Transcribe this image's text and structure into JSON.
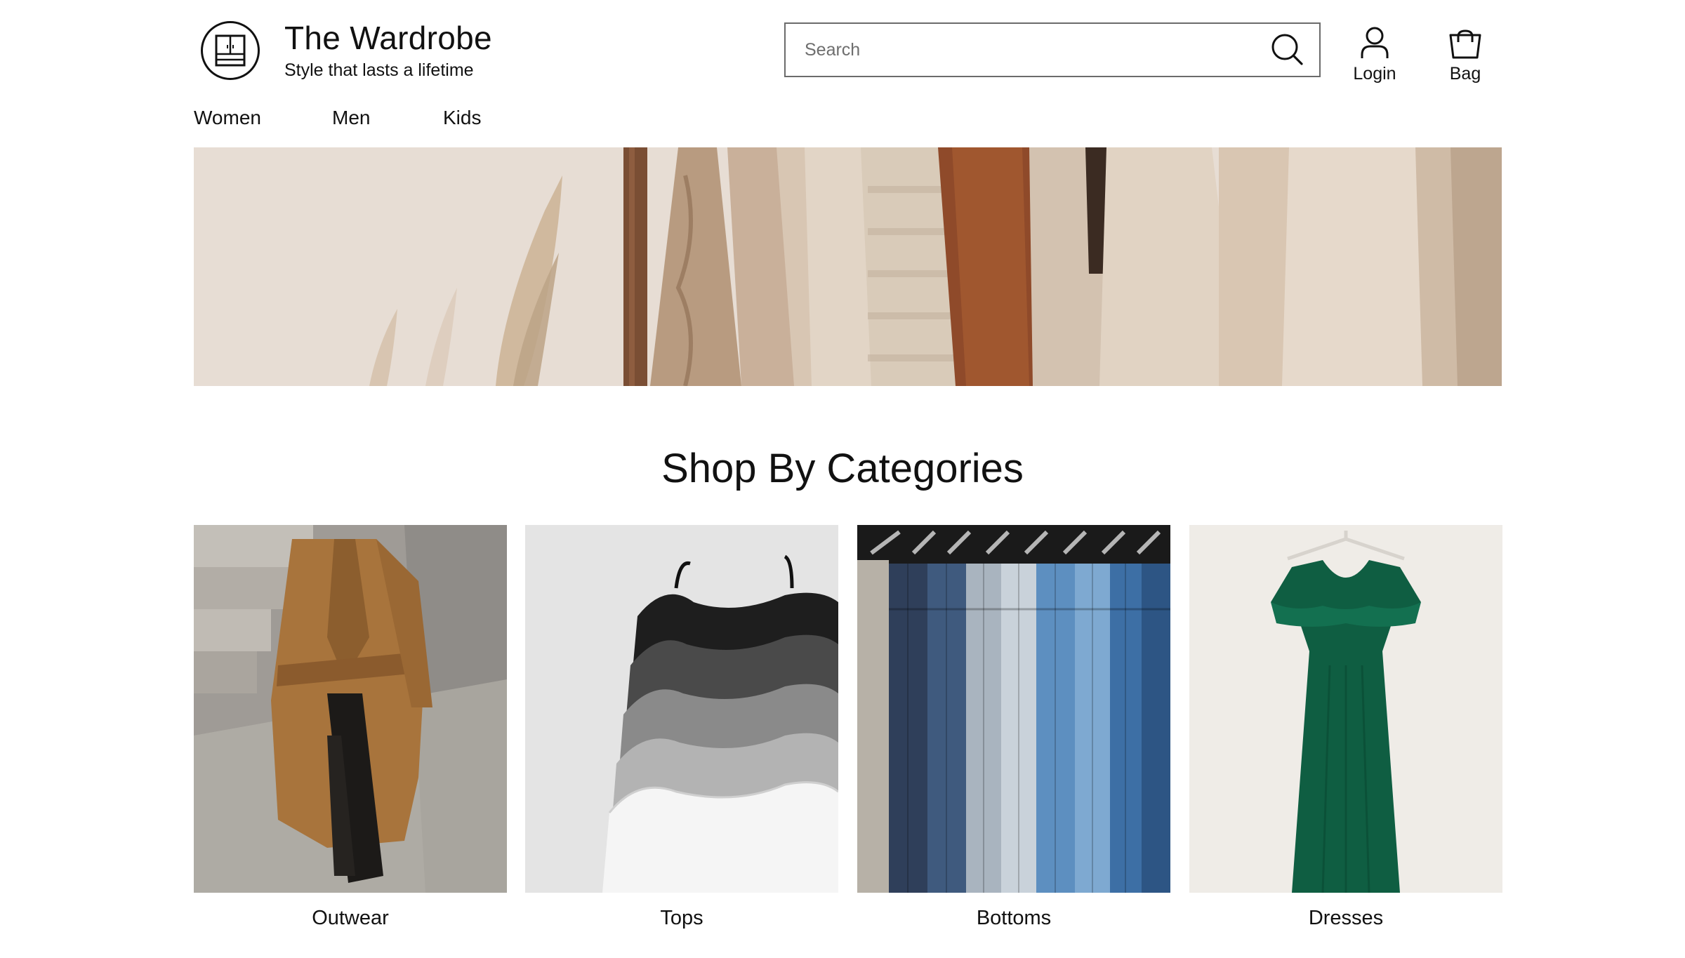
{
  "brand": {
    "name": "The Wardrobe",
    "tagline": "Style that lasts a lifetime",
    "logo_icon": "wardrobe-icon"
  },
  "search": {
    "placeholder": "Search",
    "value": "",
    "icon": "search-icon"
  },
  "actions": {
    "login_label": "Login",
    "login_icon": "user-icon",
    "bag_label": "Bag",
    "bag_icon": "shopping-bag-icon"
  },
  "nav": {
    "items": [
      {
        "label": "Women"
      },
      {
        "label": "Men"
      },
      {
        "label": "Kids"
      }
    ]
  },
  "section": {
    "title": "Shop By Categories"
  },
  "categories": [
    {
      "label": "Outwear"
    },
    {
      "label": "Tops"
    },
    {
      "label": "Bottoms"
    },
    {
      "label": "Dresses"
    }
  ]
}
